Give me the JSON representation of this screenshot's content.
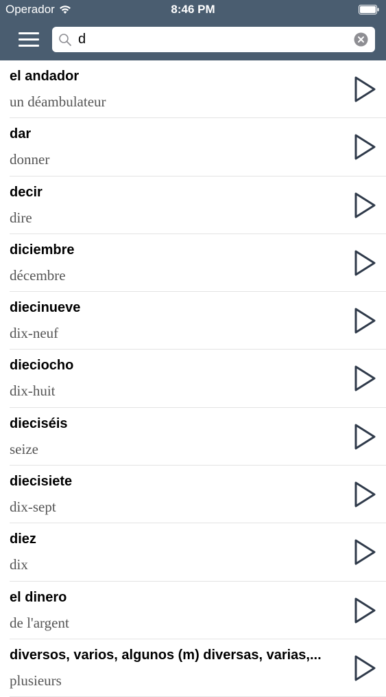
{
  "status_bar": {
    "carrier": "Operador",
    "time": "8:46 PM"
  },
  "search": {
    "value": "d",
    "placeholder": ""
  },
  "entries": [
    {
      "term": "el andador",
      "translation": "un déambulateur"
    },
    {
      "term": "dar",
      "translation": "donner"
    },
    {
      "term": "decir",
      "translation": "dire"
    },
    {
      "term": "diciembre",
      "translation": "décembre"
    },
    {
      "term": "diecinueve",
      "translation": "dix-neuf"
    },
    {
      "term": "dieciocho",
      "translation": "dix-huit"
    },
    {
      "term": "dieciséis",
      "translation": "seize"
    },
    {
      "term": "diecisiete",
      "translation": "dix-sept"
    },
    {
      "term": "diez",
      "translation": "dix"
    },
    {
      "term": "el dinero",
      "translation": "de l'argent"
    },
    {
      "term": "diversos, varios, algunos (m)  diversas, varias,...",
      "translation": "plusieurs"
    }
  ],
  "icons": {
    "menu": "hamburger-menu-icon",
    "search": "search-icon",
    "clear": "clear-icon",
    "play": "play-icon",
    "wifi": "wifi-icon",
    "battery": "battery-icon"
  },
  "colors": {
    "header": "#4a5d70",
    "divider": "#e3e3e3",
    "icon": "#2f3a4a",
    "translation_text": "#555555"
  }
}
